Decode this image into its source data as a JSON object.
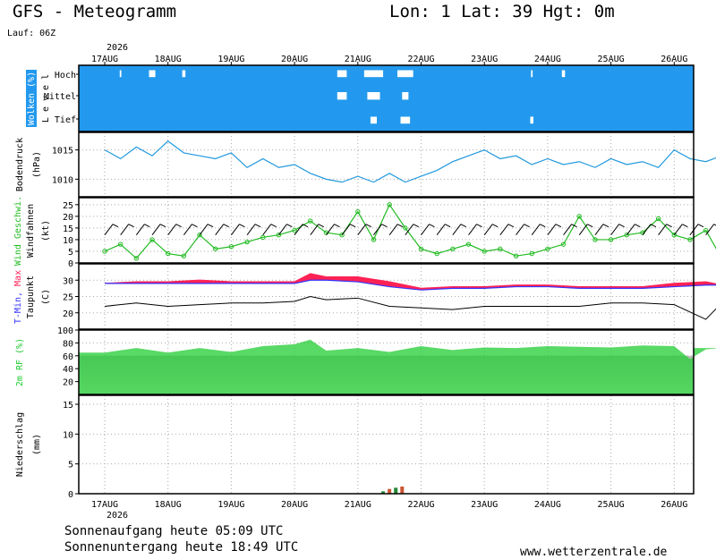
{
  "header": {
    "title": "GFS - Meteogramm",
    "coords": "Lon: 1 Lat: 39 Hgt: 0m",
    "run": "Lauf: 06Z"
  },
  "footer": {
    "sunrise": "Sonnenaufgang heute 05:09 UTC",
    "sunset": "Sonnenuntergang heute 18:49 UTC",
    "site": "www.wetterzentrale.de"
  },
  "time_axis": {
    "year": "2026",
    "dates": [
      "17AUG",
      "18AUG",
      "19AUG",
      "20AUG",
      "21AUG",
      "22AUG",
      "23AUG",
      "24AUG",
      "25AUG",
      "26AUG"
    ]
  },
  "colors": {
    "clouds": "#2299ee",
    "pressure": "#2299dd",
    "wind": "#22bb22",
    "tmax": "#ff2255",
    "tmin": "#3333ff",
    "rh": "#22cc33",
    "precip_rain": "#228833",
    "precip_conv": "#cc5533"
  },
  "chart_data": [
    {
      "type": "heatmap",
      "name": "clouds",
      "ylabel": "Wolken (%)",
      "ylabel2": "L e v e l",
      "levels": [
        "Hoch",
        "Mittel",
        "Tief"
      ],
      "x_days": [
        0,
        0.5,
        1,
        1.5,
        2,
        2.5,
        3,
        3.5,
        4,
        4.5,
        5,
        5.5,
        6,
        6.5,
        7,
        7.5,
        8,
        8.5,
        9,
        9.5
      ],
      "high_cover_pct": [
        95,
        80,
        90,
        100,
        100,
        100,
        100,
        70,
        40,
        50,
        100,
        100,
        100,
        95,
        90,
        100,
        100,
        100,
        100,
        95
      ],
      "mid_cover_pct": [
        100,
        100,
        100,
        100,
        100,
        100,
        100,
        70,
        60,
        80,
        100,
        100,
        100,
        100,
        100,
        100,
        100,
        100,
        100,
        100
      ],
      "low_cover_pct": [
        100,
        100,
        100,
        100,
        100,
        100,
        100,
        100,
        80,
        70,
        100,
        100,
        100,
        90,
        100,
        100,
        100,
        100,
        100,
        100
      ]
    },
    {
      "type": "line",
      "name": "pressure",
      "ylabel": "Bodendruck",
      "unit": "(hPa)",
      "yticks": [
        1010,
        1015
      ],
      "ylim": [
        1007,
        1018
      ],
      "x_days": [
        0,
        0.25,
        0.5,
        0.75,
        1,
        1.25,
        1.5,
        1.75,
        2,
        2.25,
        2.5,
        2.75,
        3,
        3.25,
        3.5,
        3.75,
        4,
        4.25,
        4.5,
        4.75,
        5,
        5.25,
        5.5,
        5.75,
        6,
        6.25,
        6.5,
        6.75,
        7,
        7.25,
        7.5,
        7.75,
        8,
        8.25,
        8.5,
        8.75,
        9,
        9.25,
        9.5,
        9.75
      ],
      "values": [
        1015,
        1013.5,
        1015.5,
        1014,
        1016.5,
        1014.5,
        1014,
        1013.5,
        1014.5,
        1012,
        1013.5,
        1012,
        1012.5,
        1011,
        1010,
        1009.5,
        1010.5,
        1009.5,
        1011,
        1009.5,
        1010.5,
        1011.5,
        1013,
        1014,
        1015,
        1013.5,
        1014,
        1012.5,
        1013.5,
        1012.5,
        1013,
        1012,
        1013.5,
        1012.5,
        1013,
        1012,
        1015,
        1013.5,
        1013,
        1014
      ]
    },
    {
      "type": "line",
      "name": "wind",
      "ylabel": "Wind Geschwi.",
      "ylabel2": "Windfahnen",
      "unit": "(kt)",
      "yticks": [
        0,
        5,
        10,
        15,
        20,
        25
      ],
      "ylim": [
        0,
        28
      ],
      "x_days": [
        0,
        0.25,
        0.5,
        0.75,
        1,
        1.25,
        1.5,
        1.75,
        2,
        2.25,
        2.5,
        2.75,
        3,
        3.25,
        3.5,
        3.75,
        4,
        4.25,
        4.5,
        4.75,
        5,
        5.25,
        5.5,
        5.75,
        6,
        6.25,
        6.5,
        6.75,
        7,
        7.25,
        7.5,
        7.75,
        8,
        8.25,
        8.5,
        8.75,
        9,
        9.25,
        9.5,
        9.75
      ],
      "values": [
        5,
        8,
        2,
        10,
        4,
        3,
        12,
        6,
        7,
        9,
        11,
        12,
        14,
        18,
        13,
        12,
        22,
        10,
        25,
        15,
        6,
        4,
        6,
        8,
        5,
        6,
        3,
        4,
        6,
        8,
        20,
        10,
        10,
        12,
        13,
        19,
        12,
        10,
        14,
        2
      ]
    },
    {
      "type": "line",
      "name": "temperature",
      "ylabel": "T-Min, Max",
      "ylabel2": "Taupunkt",
      "unit": "(C)",
      "yticks": [
        20,
        25,
        30
      ],
      "ylim": [
        15,
        35
      ],
      "x_days": [
        0,
        0.5,
        1,
        1.5,
        2,
        2.5,
        3,
        3.25,
        3.5,
        4,
        4.5,
        5,
        5.5,
        6,
        6.5,
        7,
        7.5,
        8,
        8.5,
        9,
        9.5,
        9.75
      ],
      "tmax": [
        29,
        29.5,
        29.5,
        30,
        29.5,
        29.5,
        29.5,
        32,
        31,
        31,
        29.5,
        27.5,
        28,
        28,
        28.5,
        28.5,
        28,
        28,
        28,
        29,
        29.5,
        28.5
      ],
      "tmin": [
        29,
        29,
        29,
        29,
        29,
        29,
        29,
        30,
        30,
        29.5,
        28,
        27,
        27.5,
        27.5,
        28,
        28,
        27.5,
        27.5,
        27.5,
        28,
        28.5,
        28.5
      ],
      "dewpoint": [
        22,
        23,
        22,
        22.5,
        23,
        23,
        23.5,
        25,
        24,
        24.5,
        22,
        21.5,
        21,
        22,
        22,
        22,
        22,
        23,
        23,
        22.5,
        18,
        23
      ]
    },
    {
      "type": "area",
      "name": "humidity",
      "ylabel": "2m RF (%)",
      "yticks": [
        20,
        40,
        60,
        80,
        100
      ],
      "ylim": [
        0,
        100
      ],
      "x_days": [
        0,
        0.5,
        1,
        1.5,
        2,
        2.5,
        3,
        3.25,
        3.5,
        4,
        4.5,
        5,
        5.5,
        6,
        6.5,
        7,
        7.5,
        8,
        8.5,
        9,
        9.25,
        9.5,
        9.75
      ],
      "values": [
        65,
        72,
        65,
        72,
        66,
        75,
        78,
        85,
        68,
        72,
        66,
        75,
        69,
        73,
        72,
        75,
        74,
        73,
        76,
        75,
        55,
        70,
        72
      ]
    },
    {
      "type": "bar",
      "name": "precipitation",
      "ylabel": "Niederschlag",
      "unit": "(mm)",
      "yticks": [
        0,
        5,
        10,
        15
      ],
      "ylim": [
        0,
        16.5
      ],
      "x_days": [
        4.4,
        4.5,
        4.6,
        4.7
      ],
      "values": [
        0.4,
        0.8,
        1.0,
        1.2
      ]
    }
  ]
}
